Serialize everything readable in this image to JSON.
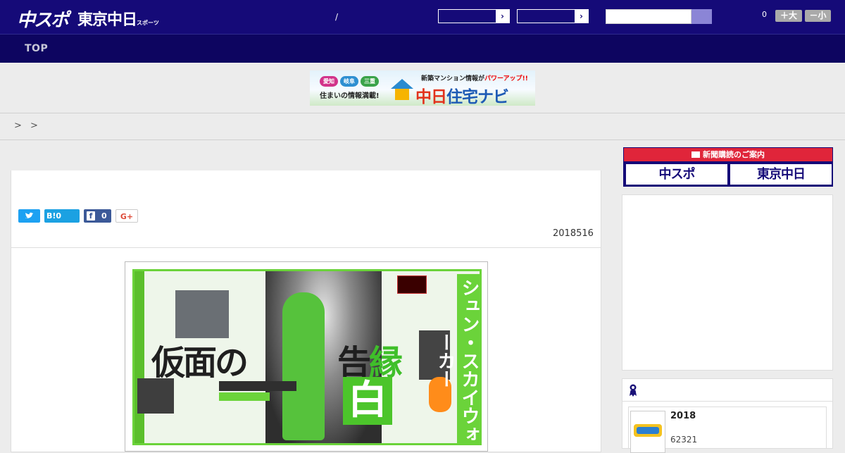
{
  "header": {
    "logo_chuspo": "中スポ",
    "logo_tokyo": "東京中日",
    "logo_tokyo_small": "スポーツ",
    "slash": "/",
    "font_count": "0",
    "font_larger": "＋大",
    "font_smaller": "－小"
  },
  "nav": {
    "top_label": "TOP"
  },
  "banner": {
    "pill_1": "愛知",
    "pill_2": "岐阜",
    "pill_3": "三重",
    "subtitle": "住まいの情報満載!",
    "top_prefix": "新築マンション情報が",
    "top_emphasis": "パワーアップ!!",
    "title_a": "中日",
    "title_b": "住宅ナビ"
  },
  "breadcrumb": {
    "text": "> >"
  },
  "article": {
    "share_twitter": "",
    "share_hatena": "B!0",
    "share_facebook_count": "0",
    "share_gplus": "G+",
    "date": "2018516"
  },
  "paper": {
    "headline_left": "仮面の",
    "headline_right_a": "告",
    "headline_right_b": "縁",
    "white_char": "白",
    "vertical_text": "シュン・スカイウォーカー"
  },
  "sidebar": {
    "subscribe_header": "新聞購読のご案内",
    "subscribe_logo_1": "中スポ",
    "subscribe_logo_2": "東京中日",
    "ranking_year": "2018",
    "ranking_number": "62321"
  },
  "colors": {
    "header_bg": "#150a78",
    "nav_bg": "#0d0560",
    "accent_red": "#e0253a",
    "accent_purple": "#7c6fc6",
    "paper_green": "#6bd33a"
  }
}
